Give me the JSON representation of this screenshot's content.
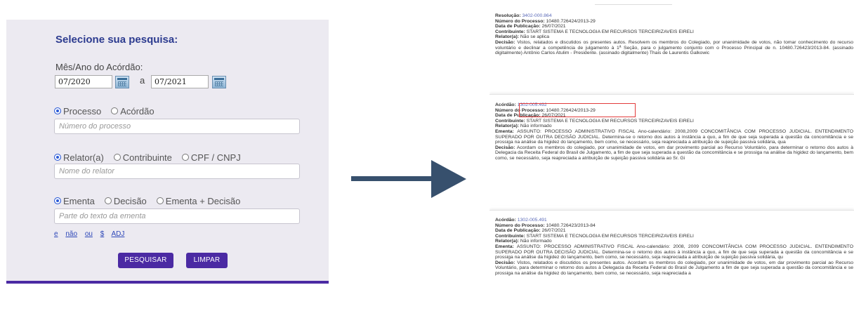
{
  "search": {
    "title": "Selecione sua pesquisa:",
    "month_year_label": "Mês/Ano do Acórdão:",
    "date_from": "07/2020",
    "date_separator": "a",
    "date_to": "07/2021",
    "process_radio": {
      "options": [
        "Processo",
        "Acórdão"
      ],
      "selected": "Processo"
    },
    "process_placeholder": "Número do processo",
    "person_radio": {
      "options": [
        "Relator(a)",
        "Contribuinte",
        "CPF / CNPJ"
      ],
      "selected": "Relator(a)"
    },
    "person_placeholder": "Nome do relator",
    "text_radio": {
      "options": [
        "Ementa",
        "Decisão",
        "Ementa + Decisão"
      ],
      "selected": "Ementa"
    },
    "text_placeholder": "Parte do texto da ementa",
    "operators": [
      "e",
      "não",
      "ou",
      "$",
      "ADJ"
    ],
    "search_button": "PESQUISAR",
    "clear_button": "LIMPAR"
  },
  "results": [
    {
      "type_label": "Resolução:",
      "id": "3402-000.864",
      "process_label": "Número do Processo:",
      "process": "10480.726424/2013-29",
      "date_label": "Data de Publicação:",
      "date": "26/07/2021",
      "contrib_label": "Contribuinte:",
      "contrib": "START SISTEMA E TECNOLOGIA EM RECURSOS TERCEIRIZAVEIS EIRELI",
      "relator_label": "Relator(a):",
      "relator": "Não se aplica",
      "decision_label": "Decisão:",
      "decision": "Vistos, relatados e discutidos os presentes autos. Resolvem os membros do Colegiado, por unanimidade de votos, não tomar conhecimento do recurso voluntário e declinar a competência de julgamento à 1ª Seção, para o julgamento conjunto com o Processo Principal de n. 10480.726423/2013-84. (assinado digitalmente) Antônio Carlos Atulim - Presidente. (assinado digitalmente) Thais de Laurentis Galkowic"
    },
    {
      "type_label": "Acórdão:",
      "id": "1302-005.492",
      "process_label": "Número do Processo:",
      "process": "10480.726424/2013-29",
      "date_label": "Data de Publicação:",
      "date": "26/07/2021",
      "contrib_label": "Contribuinte:",
      "contrib": "START SISTEMA E TECNOLOGIA EM RECURSOS TERCEIRIZAVEIS EIRELI",
      "relator_label": "Relator(a):",
      "relator": "Não informado",
      "ementa_label": "Ementa:",
      "ementa": "ASSUNTO: PROCESSO ADMINISTRATIVO FISCAL Ano-calendário: 2008,2009 CONCOMITÂNCIA COM PROCESSO JUDICIAL. ENTENDIMENTO SUPERADO POR OUTRA DECISÃO JUDICIAL. Determina-se o retorno dos autos à instância a quo, a fim de que seja superada a questão da concomitância e se prossiga na análise da higidez do lançamento, bem como, se necessário, seja reapreciada a atribuição de sujeição passiva solidária, qua",
      "decision_label": "Decisão:",
      "decision": "Acordam os membros do colegiado, por unanimidade de votos, em dar provimento parcial ao Recurso Voluntário, para determinar o retorno dos autos à Delegacia da Receita Federal do Brasil de Julgamento, a fim de que seja superada a questão da concomitância e se prossiga na análise da higidez do lançamento, bem como, se necessário, seja reapreciada a atribuição de sujeição passiva solidária ao Sr. Gi"
    },
    {
      "type_label": "Acórdão:",
      "id": "1302-005.491",
      "process_label": "Número do Processo:",
      "process": "10480.726423/2013-84",
      "date_label": "Data de Publicação:",
      "date": "26/07/2021",
      "contrib_label": "Contribuinte:",
      "contrib": "START SISTEMA E TECNOLOGIA EM RECURSOS TERCEIRIZAVEIS EIRELI",
      "relator_label": "Relator(a):",
      "relator": "Não informado",
      "ementa_label": "Ementa:",
      "ementa": "ASSUNTO: PROCESSO ADMINISTRATIVO FISCAL Ano-calendário: 2008, 2009 CONCOMITÂNCIA COM PROCESSO JUDICIAL. ENTENDIMENTO SUPERADO POR OUTRA DECISÃO JUDICIAL. Determina-se o retorno dos autos à instância a quo, a fim de que seja superada a questão da concomitância e se prossiga na análise da higidez do lançamento, bem como, se necessário, seja reapreciada a atribuição de sujeição passiva solidária, qu",
      "decision_label": "Decisão:",
      "decision": "Vistos, relatados e discutidos os presentes autos. Acordam os membros do colegiado, por unanimidade de votos, em dar provimento parcial ao Recurso Voluntário, para determinar o retorno dos autos à Delegacia da Receita Federal do Brasil de Julgamento a fim de que seja superada a questão da concomitância e se prossiga na análise da higidez do lançamento, bem como, se necessário, seja reapreciada a"
    }
  ],
  "colors": {
    "accent": "#4b2aa3",
    "title": "#2c3b8f",
    "highlight": "#e23c3c",
    "arrow": "#37506d"
  }
}
